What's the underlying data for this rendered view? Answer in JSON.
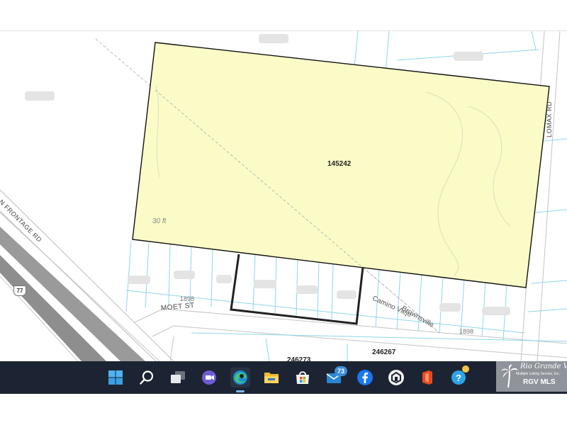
{
  "map": {
    "parcel_main": "145242",
    "scale_label": "30 ft",
    "parcel_b": "246267",
    "parcel_c": "246273",
    "lot_1": "1898",
    "lot_2": "1898",
    "hwy_shield": "77",
    "streets": {
      "moet": "MOET ST",
      "frontage": "N FRONTAGE RD",
      "lomax": "LOMAX RD",
      "brownsville": "Brownsville",
      "camino": "Camino Viejo"
    },
    "colors": {
      "parcel_fill": "#fbfbc7",
      "parcel_outline": "#111111",
      "lot_lines": "#8fd6ea",
      "highway": "#888888"
    }
  },
  "taskbar": {
    "icons": [
      "windows-start-icon",
      "search-icon",
      "task-view-icon",
      "teams-chat-icon",
      "edge-icon",
      "file-explorer-icon",
      "store-icon",
      "mail-icon",
      "facebook-icon",
      "app-icon",
      "office-icon",
      "tips-icon"
    ],
    "mail_badge": "73"
  },
  "brand": {
    "name": "Rio Grande Valley",
    "tagline": "Multiple Listing Service, Inc.",
    "mls": "RGV MLS"
  }
}
